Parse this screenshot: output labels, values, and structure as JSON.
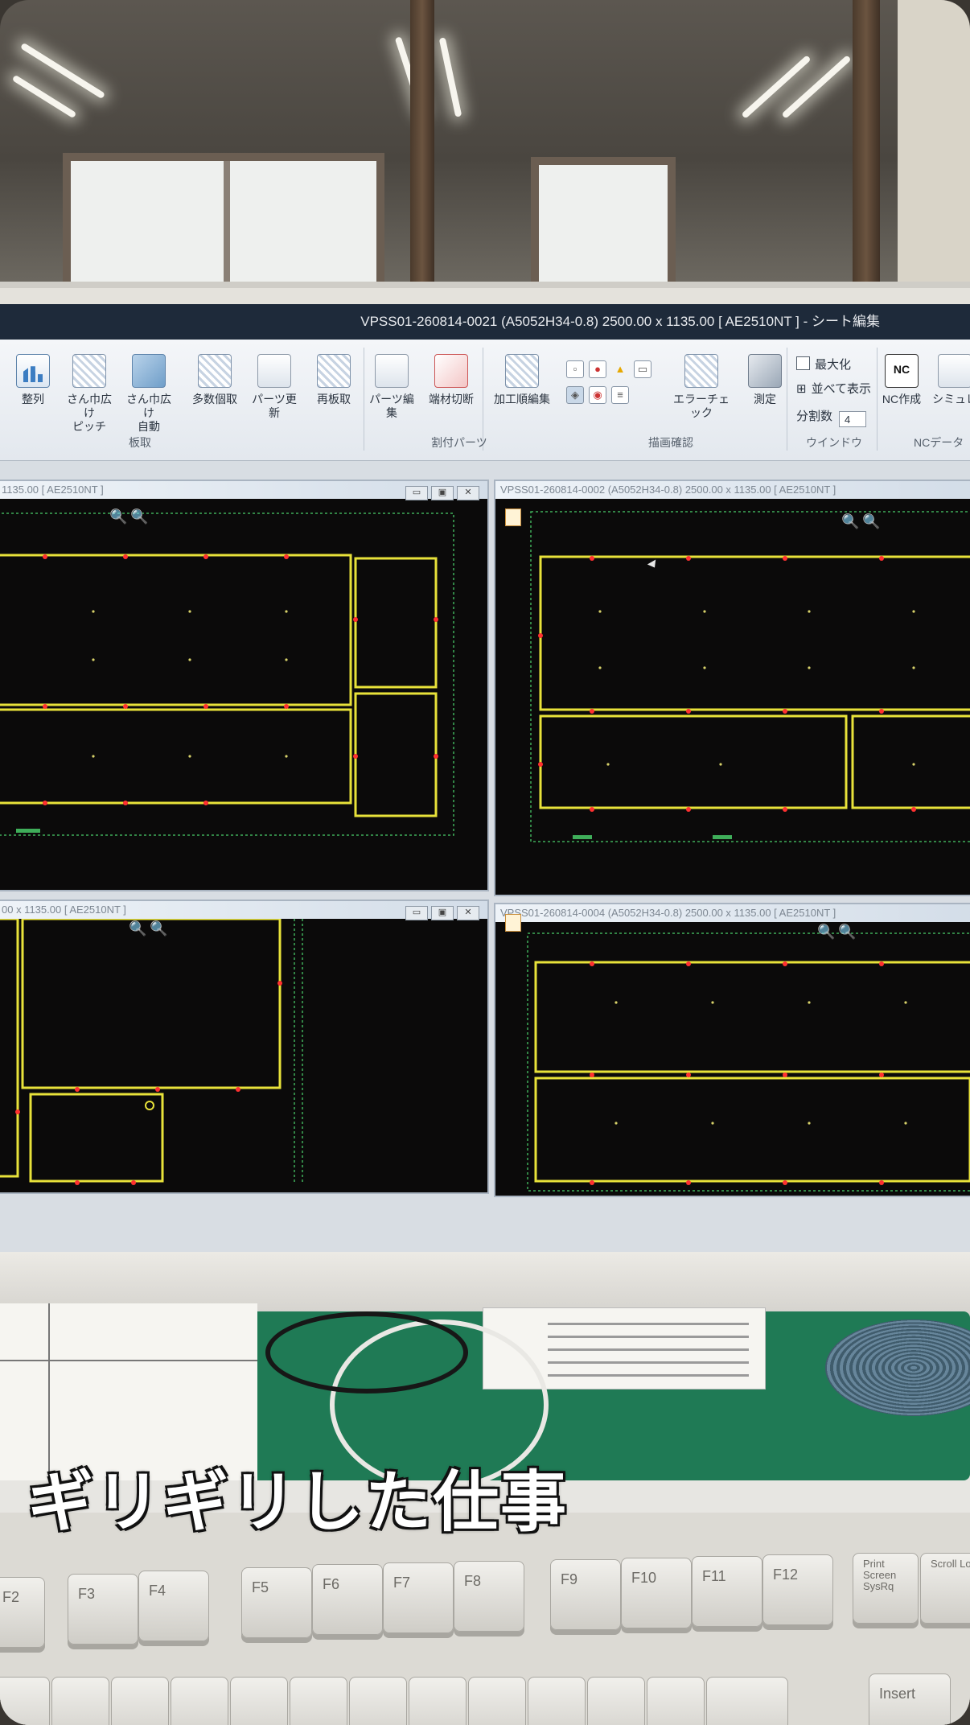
{
  "window": {
    "title": "VPSS01-260814-0021 (A5052H34-0.8) 2500.00 x 1135.00 [ AE2510NT ] - シート編集"
  },
  "ribbon": {
    "buttons": [
      {
        "label": "整列"
      },
      {
        "label": "さん巾広け\nピッチ"
      },
      {
        "label": "さん巾広け\n自動"
      },
      {
        "label": "多数個取"
      },
      {
        "label": "パーツ更新"
      },
      {
        "label": "再板取"
      },
      {
        "label": "パーツ編集"
      },
      {
        "label": "端材切断"
      },
      {
        "label": "加工順編集"
      },
      {
        "label": "エラーチェック"
      },
      {
        "label": "測定"
      },
      {
        "label": "NC作成"
      },
      {
        "label": "シミュレ"
      }
    ],
    "groups": {
      "g1": "板取",
      "g2": "割付パーツ",
      "g3": "描画確認",
      "g4": "ウインドウ",
      "g5": "NCデータ"
    },
    "window_opts": {
      "maximize": "最大化",
      "tile_all": "並べて表示",
      "split_label": "分割数",
      "split_value": "4"
    }
  },
  "panes": [
    {
      "title": "1135.00 [ AE2510NT ]"
    },
    {
      "title": "VPSS01-260814-0002 (A5052H34-0.8) 2500.00 x 1135.00 [ AE2510NT ]"
    },
    {
      "title": "00 x 1135.00 [ AE2510NT ]"
    },
    {
      "title": "VPSS01-260814-0004 (A5052H34-0.8) 2500.00 x 1135.00 [ AE2510NT ]"
    }
  ],
  "caption": "ギリギリした仕事",
  "keyboard": {
    "fkeys": [
      "F2",
      "F3",
      "F4",
      "F5",
      "F6",
      "F7",
      "F8",
      "F9",
      "F10",
      "F11",
      "F12"
    ],
    "special": [
      "Print Screen SysRq",
      "Scroll Lock",
      "Insert"
    ]
  },
  "colors": {
    "part_outline": "#e8e23a",
    "sheet_grid": "#3fae5a",
    "marker": "#ff3030",
    "canvas_bg": "#0b0a0a"
  }
}
